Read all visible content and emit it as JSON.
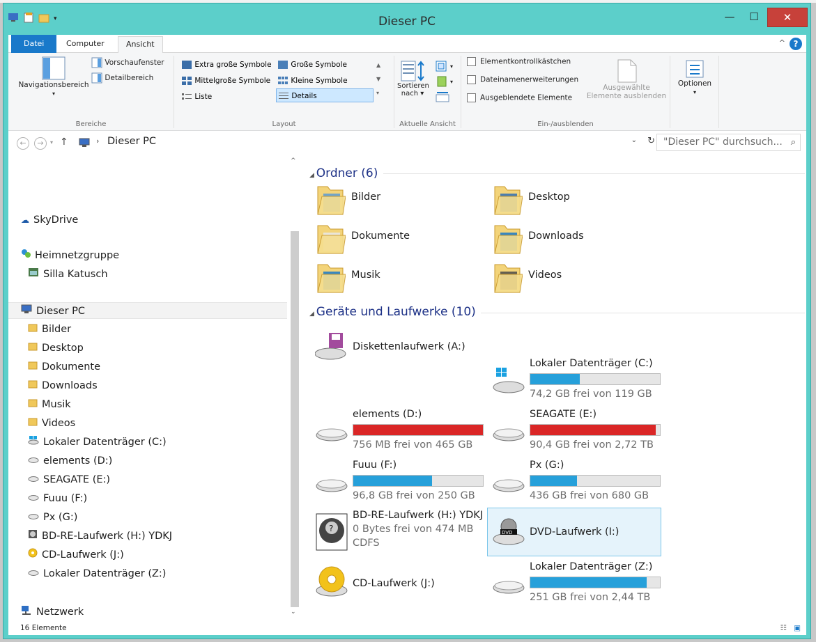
{
  "window": {
    "title": "Dieser PC",
    "controls": {
      "minimize": "—",
      "maximize": "☐",
      "close": "✕"
    }
  },
  "ribbon": {
    "tabs": [
      {
        "label": "Datei"
      },
      {
        "label": "Computer"
      },
      {
        "label": "Ansicht"
      }
    ],
    "help": "?",
    "bereiche": {
      "label": "Bereiche",
      "nav_pane": "Navigationsbereich",
      "preview": "Vorschaufenster",
      "details": "Detailbereich"
    },
    "layout": {
      "label": "Layout",
      "items": [
        "Extra große Symbole",
        "Große Symbole",
        "Mittelgroße Symbole",
        "Kleine Symbole",
        "Liste",
        "Details"
      ],
      "selected": "Details"
    },
    "current_view": {
      "label": "Aktuelle Ansicht",
      "sort": "Sortieren nach"
    },
    "show_hide": {
      "label": "Ein-/ausblenden",
      "checkboxes": [
        "Elementkontrollkästchen",
        "Dateinamenerweiterungen",
        "Ausgeblendete Elemente"
      ],
      "hide_selected": "Ausgewählte Elemente ausblenden"
    },
    "options": "Optionen"
  },
  "address": {
    "path": "Dieser PC",
    "search_placeholder": "\"Dieser PC\" durchsuch..."
  },
  "nav": {
    "skydrive": "SkyDrive",
    "homegroup": "Heimnetzgruppe",
    "homegroup_user": "Silla Katusch",
    "thispc": "Dieser PC",
    "items": [
      "Bilder",
      "Desktop",
      "Dokumente",
      "Downloads",
      "Musik",
      "Videos",
      "Lokaler Datenträger (C:)",
      "elements (D:)",
      "SEAGATE (E:)",
      "Fuuu (F:)",
      "Px (G:)",
      "BD-RE-Laufwerk (H:) YDKJ",
      "CD-Laufwerk (J:)",
      "Lokaler Datenträger (Z:)"
    ],
    "network": "Netzwerk"
  },
  "folders": {
    "header": "Ordner (6)",
    "items": [
      "Bilder",
      "Desktop",
      "Dokumente",
      "Downloads",
      "Musik",
      "Videos"
    ]
  },
  "drives": {
    "header": "Geräte und Laufwerke (10)",
    "floppy": "Diskettenlaufwerk (A:)",
    "c": {
      "name": "Lokaler Datenträger (C:)",
      "free": "74,2 GB frei von 119 GB",
      "used_pct": 38
    },
    "d": {
      "name": "elements (D:)",
      "free": "756 MB frei von 465 GB",
      "used_pct": 99.8
    },
    "e": {
      "name": "SEAGATE (E:)",
      "free": "90,4 GB frei von 2,72 TB",
      "used_pct": 97
    },
    "f": {
      "name": "Fuuu (F:)",
      "free": "96,8 GB frei von 250 GB",
      "used_pct": 61
    },
    "g": {
      "name": "Px (G:)",
      "free": "436 GB frei von 680 GB",
      "used_pct": 36
    },
    "h": {
      "name": "BD-RE-Laufwerk (H:) YDKJ",
      "free": "0 Bytes frei von 474 MB",
      "fs": "CDFS"
    },
    "i": {
      "name": "DVD-Laufwerk (I:)"
    },
    "j": {
      "name": "CD-Laufwerk (J:)"
    },
    "z": {
      "name": "Lokaler Datenträger (Z:)",
      "free": "251 GB frei von 2,44 TB",
      "used_pct": 90
    }
  },
  "status": {
    "count": "16 Elemente"
  },
  "colors": {
    "bar_ok": "#26a0da",
    "bar_full": "#da2626",
    "frame": "#5ccfca",
    "accent": "#1979ca"
  }
}
